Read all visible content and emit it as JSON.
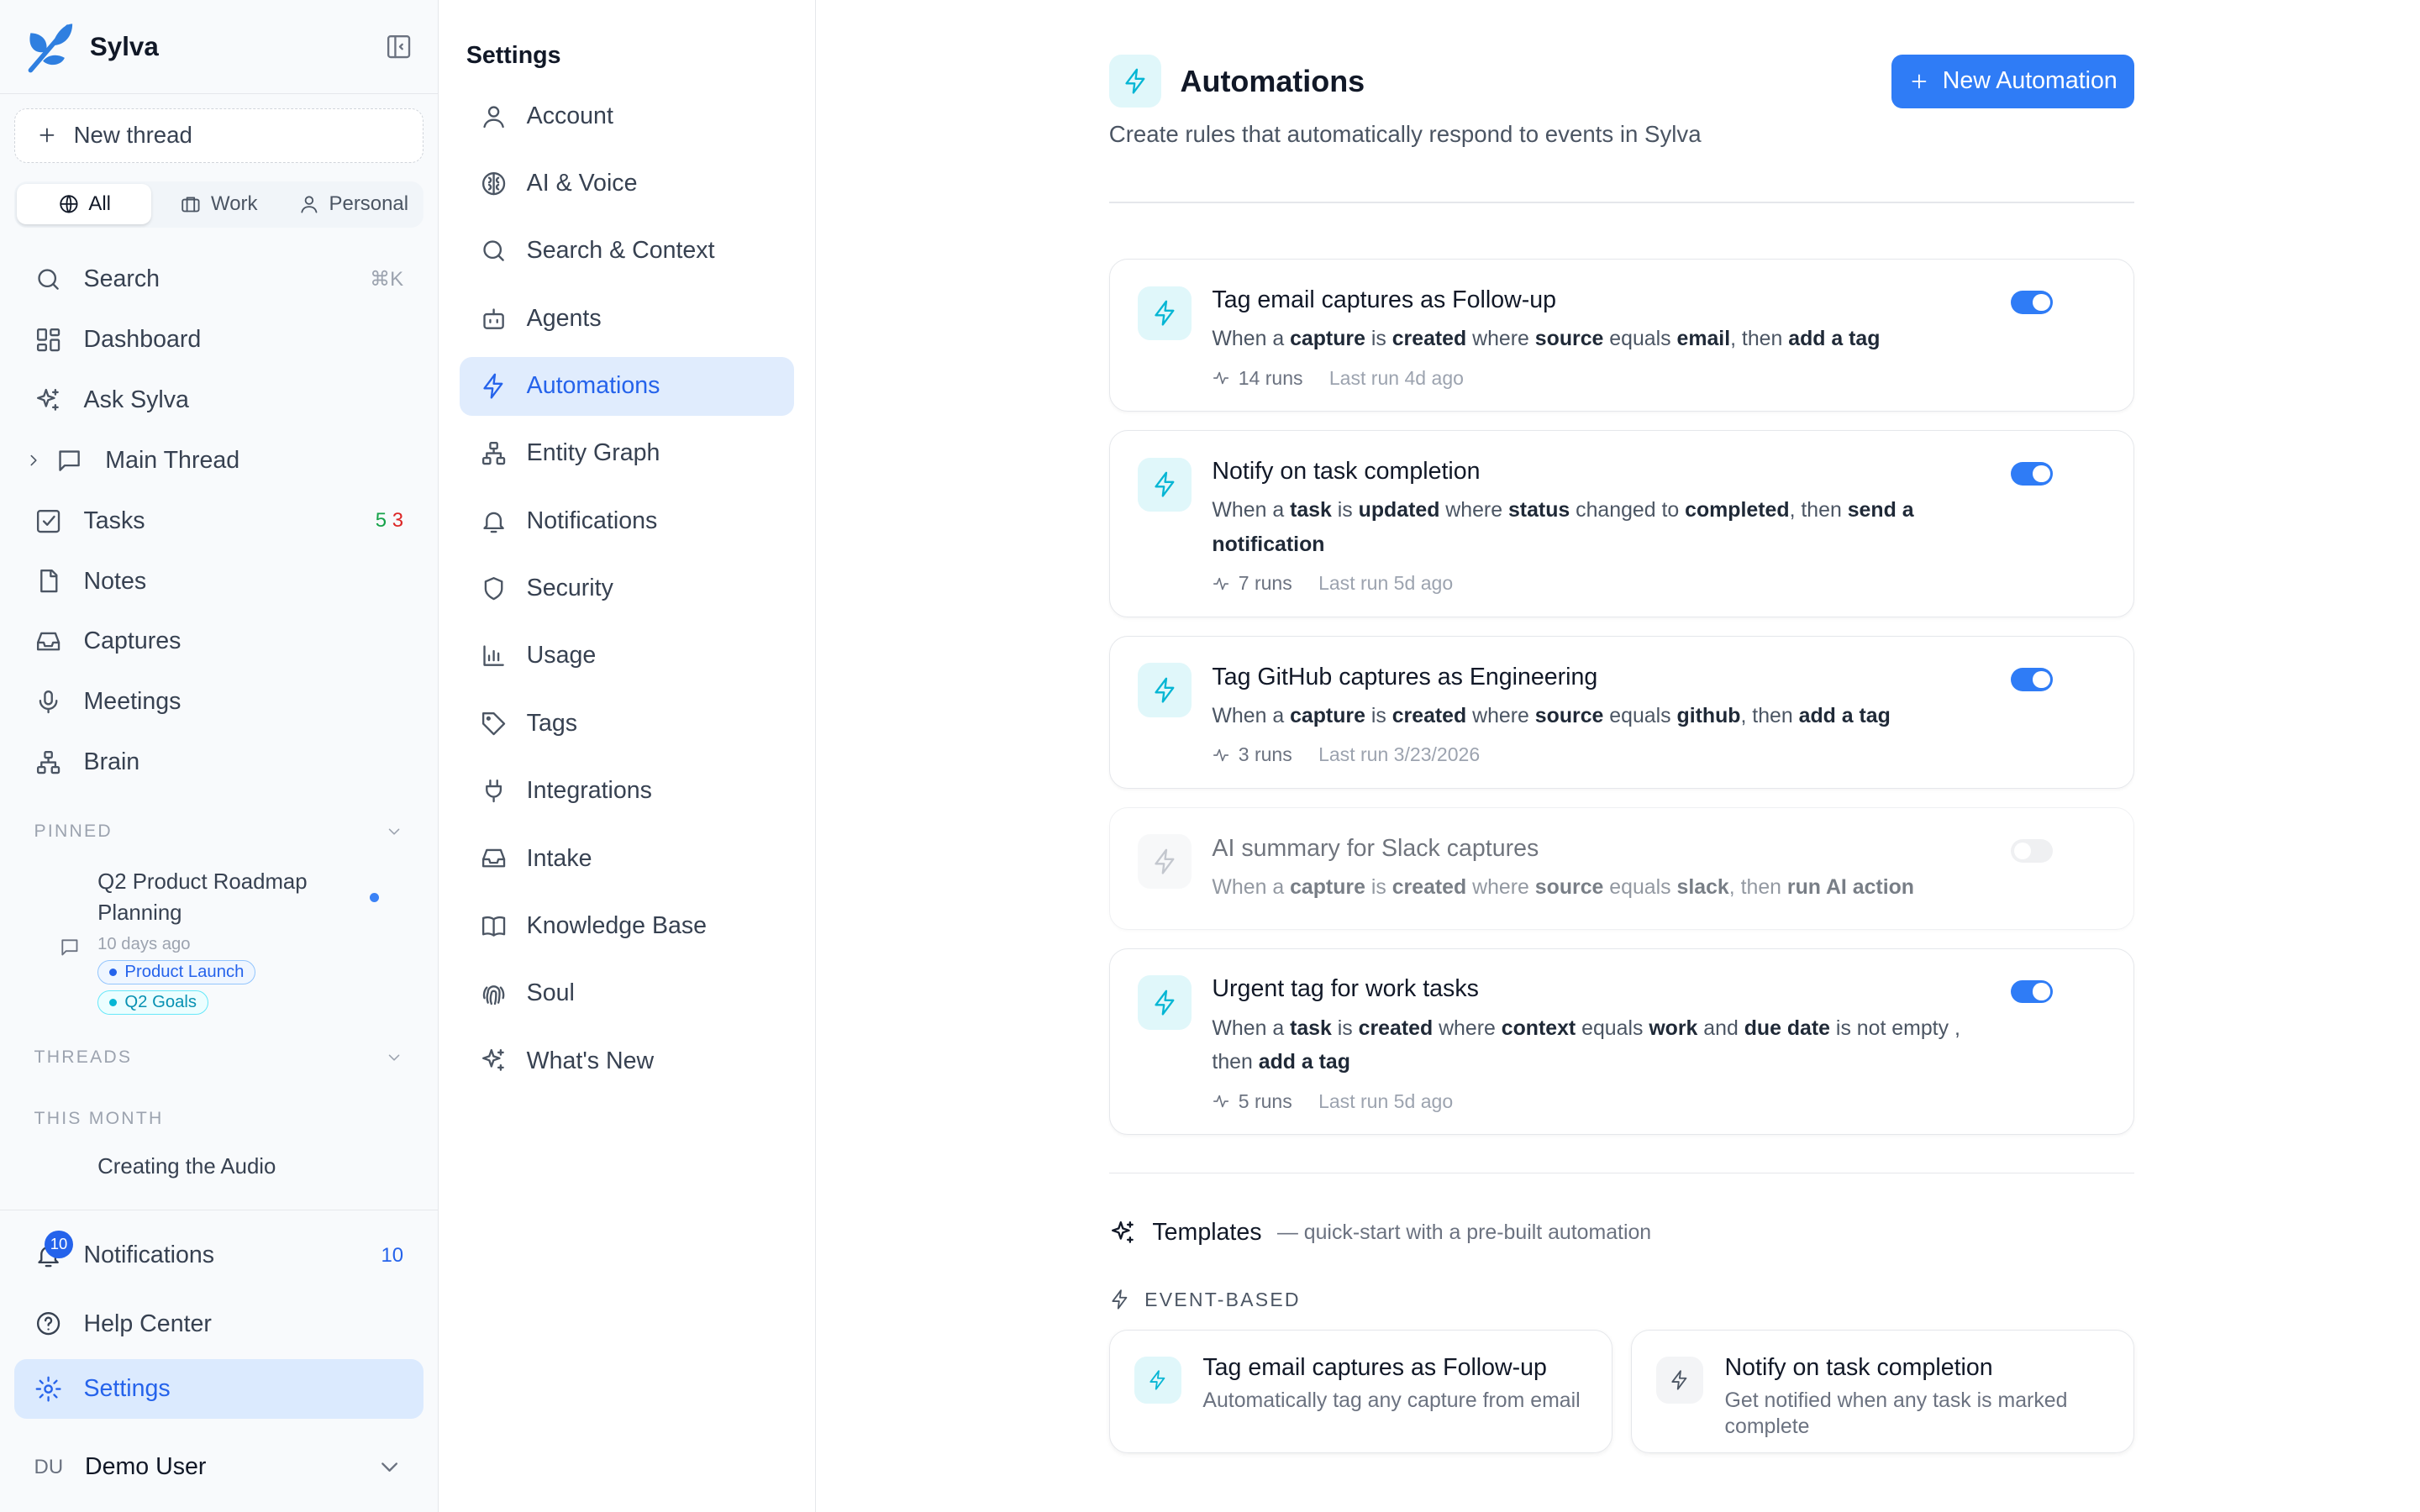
{
  "brand": {
    "name": "Sylva"
  },
  "sidebar": {
    "new_thread": "New thread",
    "filters": [
      "All",
      "Work",
      "Personal"
    ],
    "search": {
      "label": "Search",
      "shortcut": "⌘K"
    },
    "nav": [
      "Dashboard",
      "Ask Sylva",
      "Main Thread",
      "Tasks",
      "Notes",
      "Captures",
      "Meetings",
      "Brain"
    ],
    "tasks_counts": {
      "green": "5",
      "red": "3"
    },
    "pinned_header": "PINNED",
    "pinned_item": {
      "title": "Q2 Product Roadmap Planning",
      "ago": "10 days ago",
      "tags": [
        "Product Launch",
        "Q2 Goals"
      ]
    },
    "threads_header": "THREADS",
    "this_month_header": "THIS MONTH",
    "partial_thread": "Creating the Audio",
    "notifications": {
      "label": "Notifications",
      "count": "10",
      "badge": "10"
    },
    "help": "Help Center",
    "settings": "Settings",
    "user": {
      "initials": "DU",
      "name": "Demo User"
    }
  },
  "settings_nav": {
    "title": "Settings",
    "items": [
      "Account",
      "AI & Voice",
      "Search & Context",
      "Agents",
      "Automations",
      "Entity Graph",
      "Notifications",
      "Security",
      "Usage",
      "Tags",
      "Integrations",
      "Intake",
      "Knowledge Base",
      "Soul",
      "What's New"
    ],
    "active": "Automations"
  },
  "main": {
    "title": "Automations",
    "subtitle": "Create rules that automatically respond to events in Sylva",
    "new_button": "New Automation",
    "automations": [
      {
        "title": "Tag email captures as Follow-up",
        "desc": [
          [
            "When a ",
            0
          ],
          [
            "capture",
            1
          ],
          [
            " is ",
            0
          ],
          [
            "created",
            1
          ],
          [
            " where ",
            0
          ],
          [
            "source",
            1
          ],
          [
            " equals ",
            0
          ],
          [
            "email",
            1
          ],
          [
            ", then ",
            0
          ],
          [
            "add a tag",
            1
          ]
        ],
        "runs": "14 runs",
        "last": "Last run 4d ago",
        "enabled": true
      },
      {
        "title": "Notify on task completion",
        "desc": [
          [
            "When a ",
            0
          ],
          [
            "task",
            1
          ],
          [
            " is ",
            0
          ],
          [
            "updated",
            1
          ],
          [
            " where ",
            0
          ],
          [
            "status",
            1
          ],
          [
            " changed to ",
            0
          ],
          [
            "completed",
            1
          ],
          [
            ", then ",
            0
          ],
          [
            "send a notification",
            1
          ]
        ],
        "runs": "7 runs",
        "last": "Last run 5d ago",
        "enabled": true
      },
      {
        "title": "Tag GitHub captures as Engineering",
        "desc": [
          [
            "When a ",
            0
          ],
          [
            "capture",
            1
          ],
          [
            " is ",
            0
          ],
          [
            "created",
            1
          ],
          [
            " where ",
            0
          ],
          [
            "source",
            1
          ],
          [
            " equals ",
            0
          ],
          [
            "github",
            1
          ],
          [
            ", then ",
            0
          ],
          [
            "add a tag",
            1
          ]
        ],
        "runs": "3 runs",
        "last": "Last run 3/23/2026",
        "enabled": true
      },
      {
        "title": "AI summary for Slack captures",
        "desc": [
          [
            "When a ",
            0
          ],
          [
            "capture",
            1
          ],
          [
            " is ",
            0
          ],
          [
            "created",
            1
          ],
          [
            " where ",
            0
          ],
          [
            "source",
            1
          ],
          [
            " equals ",
            0
          ],
          [
            "slack",
            1
          ],
          [
            ", then ",
            0
          ],
          [
            "run AI action",
            1
          ]
        ],
        "runs": "",
        "last": "",
        "enabled": false
      },
      {
        "title": "Urgent tag for work tasks",
        "desc": [
          [
            "When a ",
            0
          ],
          [
            "task",
            1
          ],
          [
            " is ",
            0
          ],
          [
            "created",
            1
          ],
          [
            " where ",
            0
          ],
          [
            "context",
            1
          ],
          [
            " equals ",
            0
          ],
          [
            "work",
            1
          ],
          [
            " and ",
            0
          ],
          [
            "due date",
            1
          ],
          [
            " is not empty , then ",
            0
          ],
          [
            "add a tag",
            1
          ]
        ],
        "runs": "5 runs",
        "last": "Last run 5d ago",
        "enabled": true
      }
    ],
    "templates": {
      "title": "Templates",
      "subtitle": "— quick-start with a pre-built automation",
      "section": "EVENT-BASED",
      "items": [
        {
          "title": "Tag email captures as Follow-up",
          "desc": "Automatically tag any capture from email"
        },
        {
          "title": "Notify on task completion",
          "desc": "Get notified when any task is marked complete"
        }
      ]
    }
  },
  "colors": {
    "accent": "#2f7cf6",
    "bolt": "#06b6d4",
    "active_bg": "#dbeafe"
  }
}
